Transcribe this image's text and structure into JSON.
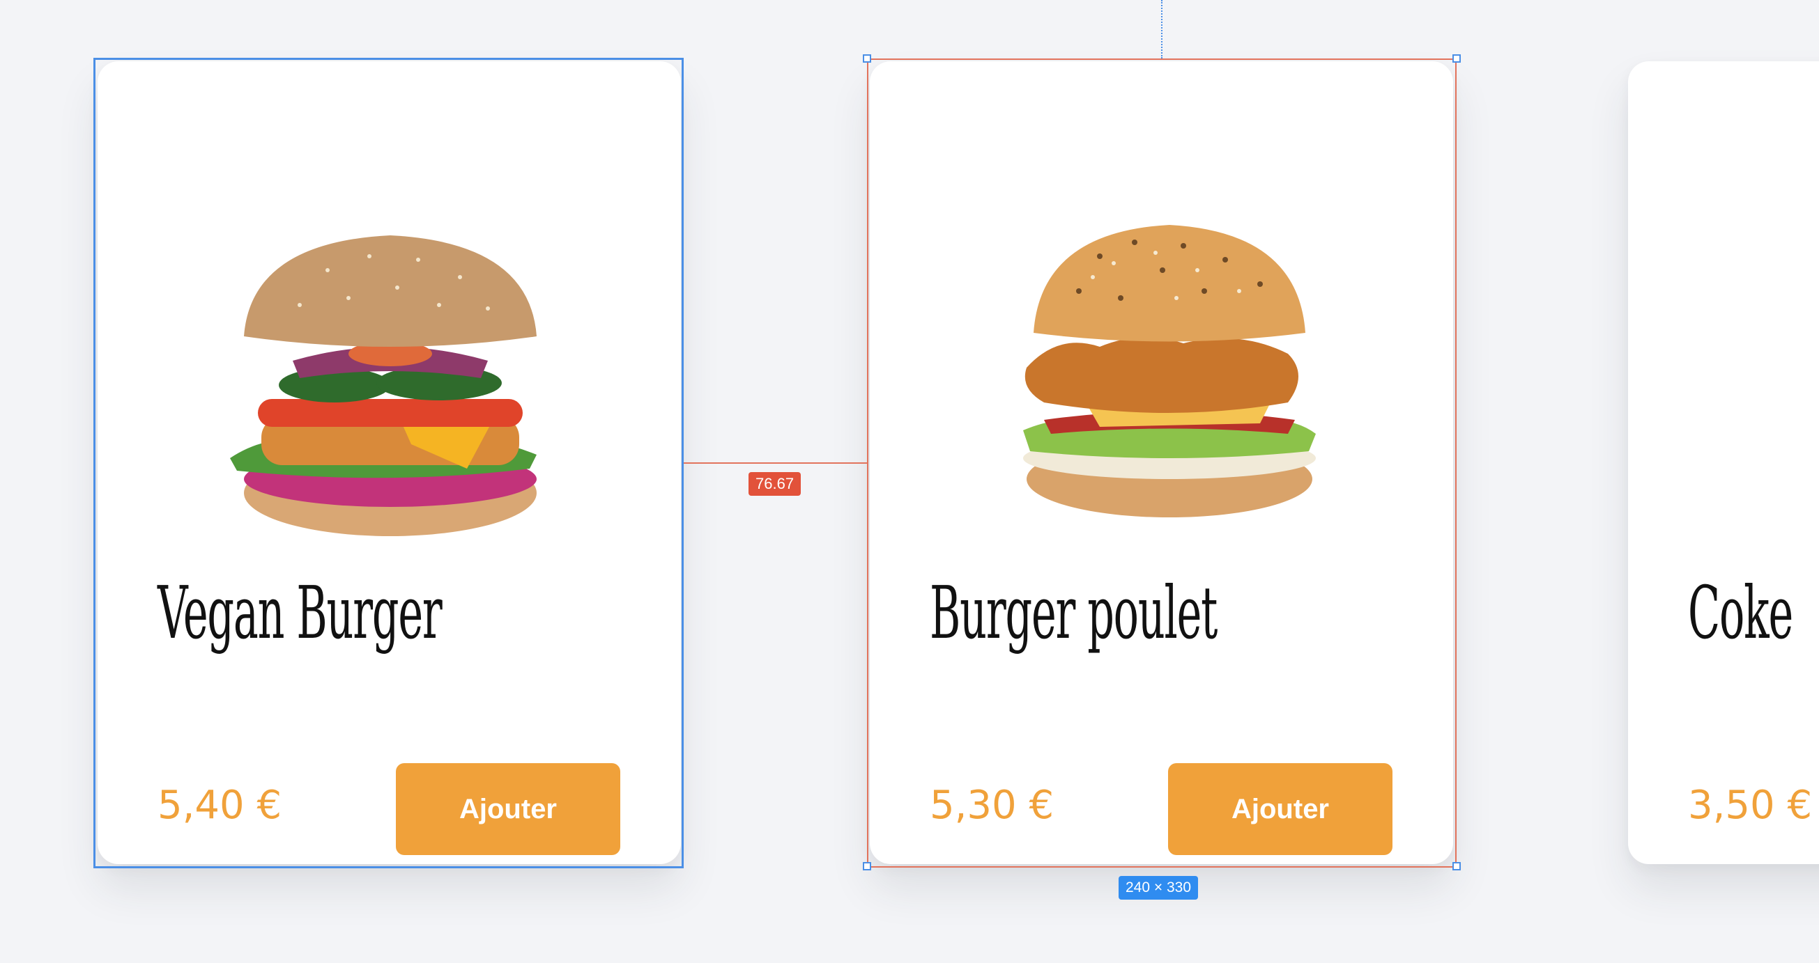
{
  "products": [
    {
      "title": "Vegan Burger",
      "price": "5,40 €",
      "button_label": "Ajouter"
    },
    {
      "title": "Burger poulet",
      "price": "5,30 €",
      "button_label": "Ajouter"
    },
    {
      "title": "Coke",
      "price": "3,50 €"
    }
  ],
  "overlay": {
    "spacing_label": "76.67",
    "size_label": "240 × 330"
  },
  "colors": {
    "background": "#f3f4f7",
    "card": "#ffffff",
    "accent": "#f0a13a",
    "selection": "#4b8fe6",
    "measure": "#e2523a"
  },
  "icons": {
    "card_1_image": "vegan-burger-image",
    "card_2_image": "chicken-burger-image"
  }
}
